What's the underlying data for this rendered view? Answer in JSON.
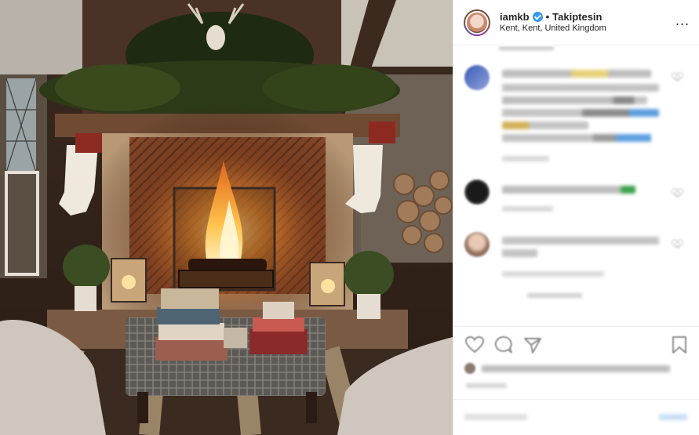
{
  "post": {
    "username": "iamkb",
    "follow_separator": "•",
    "follow_status": "Takiptesin",
    "location": "Kent, Kent, United Kingdom",
    "more_options": "..."
  },
  "icons": {
    "verified": "verified-badge-icon",
    "more": "more-options-icon",
    "like": "heart-icon",
    "comment": "comment-icon",
    "share": "share-icon",
    "save": "bookmark-icon"
  },
  "colors": {
    "verified_blue": "#3897f0",
    "border": "#efefef",
    "text": "#262626"
  }
}
